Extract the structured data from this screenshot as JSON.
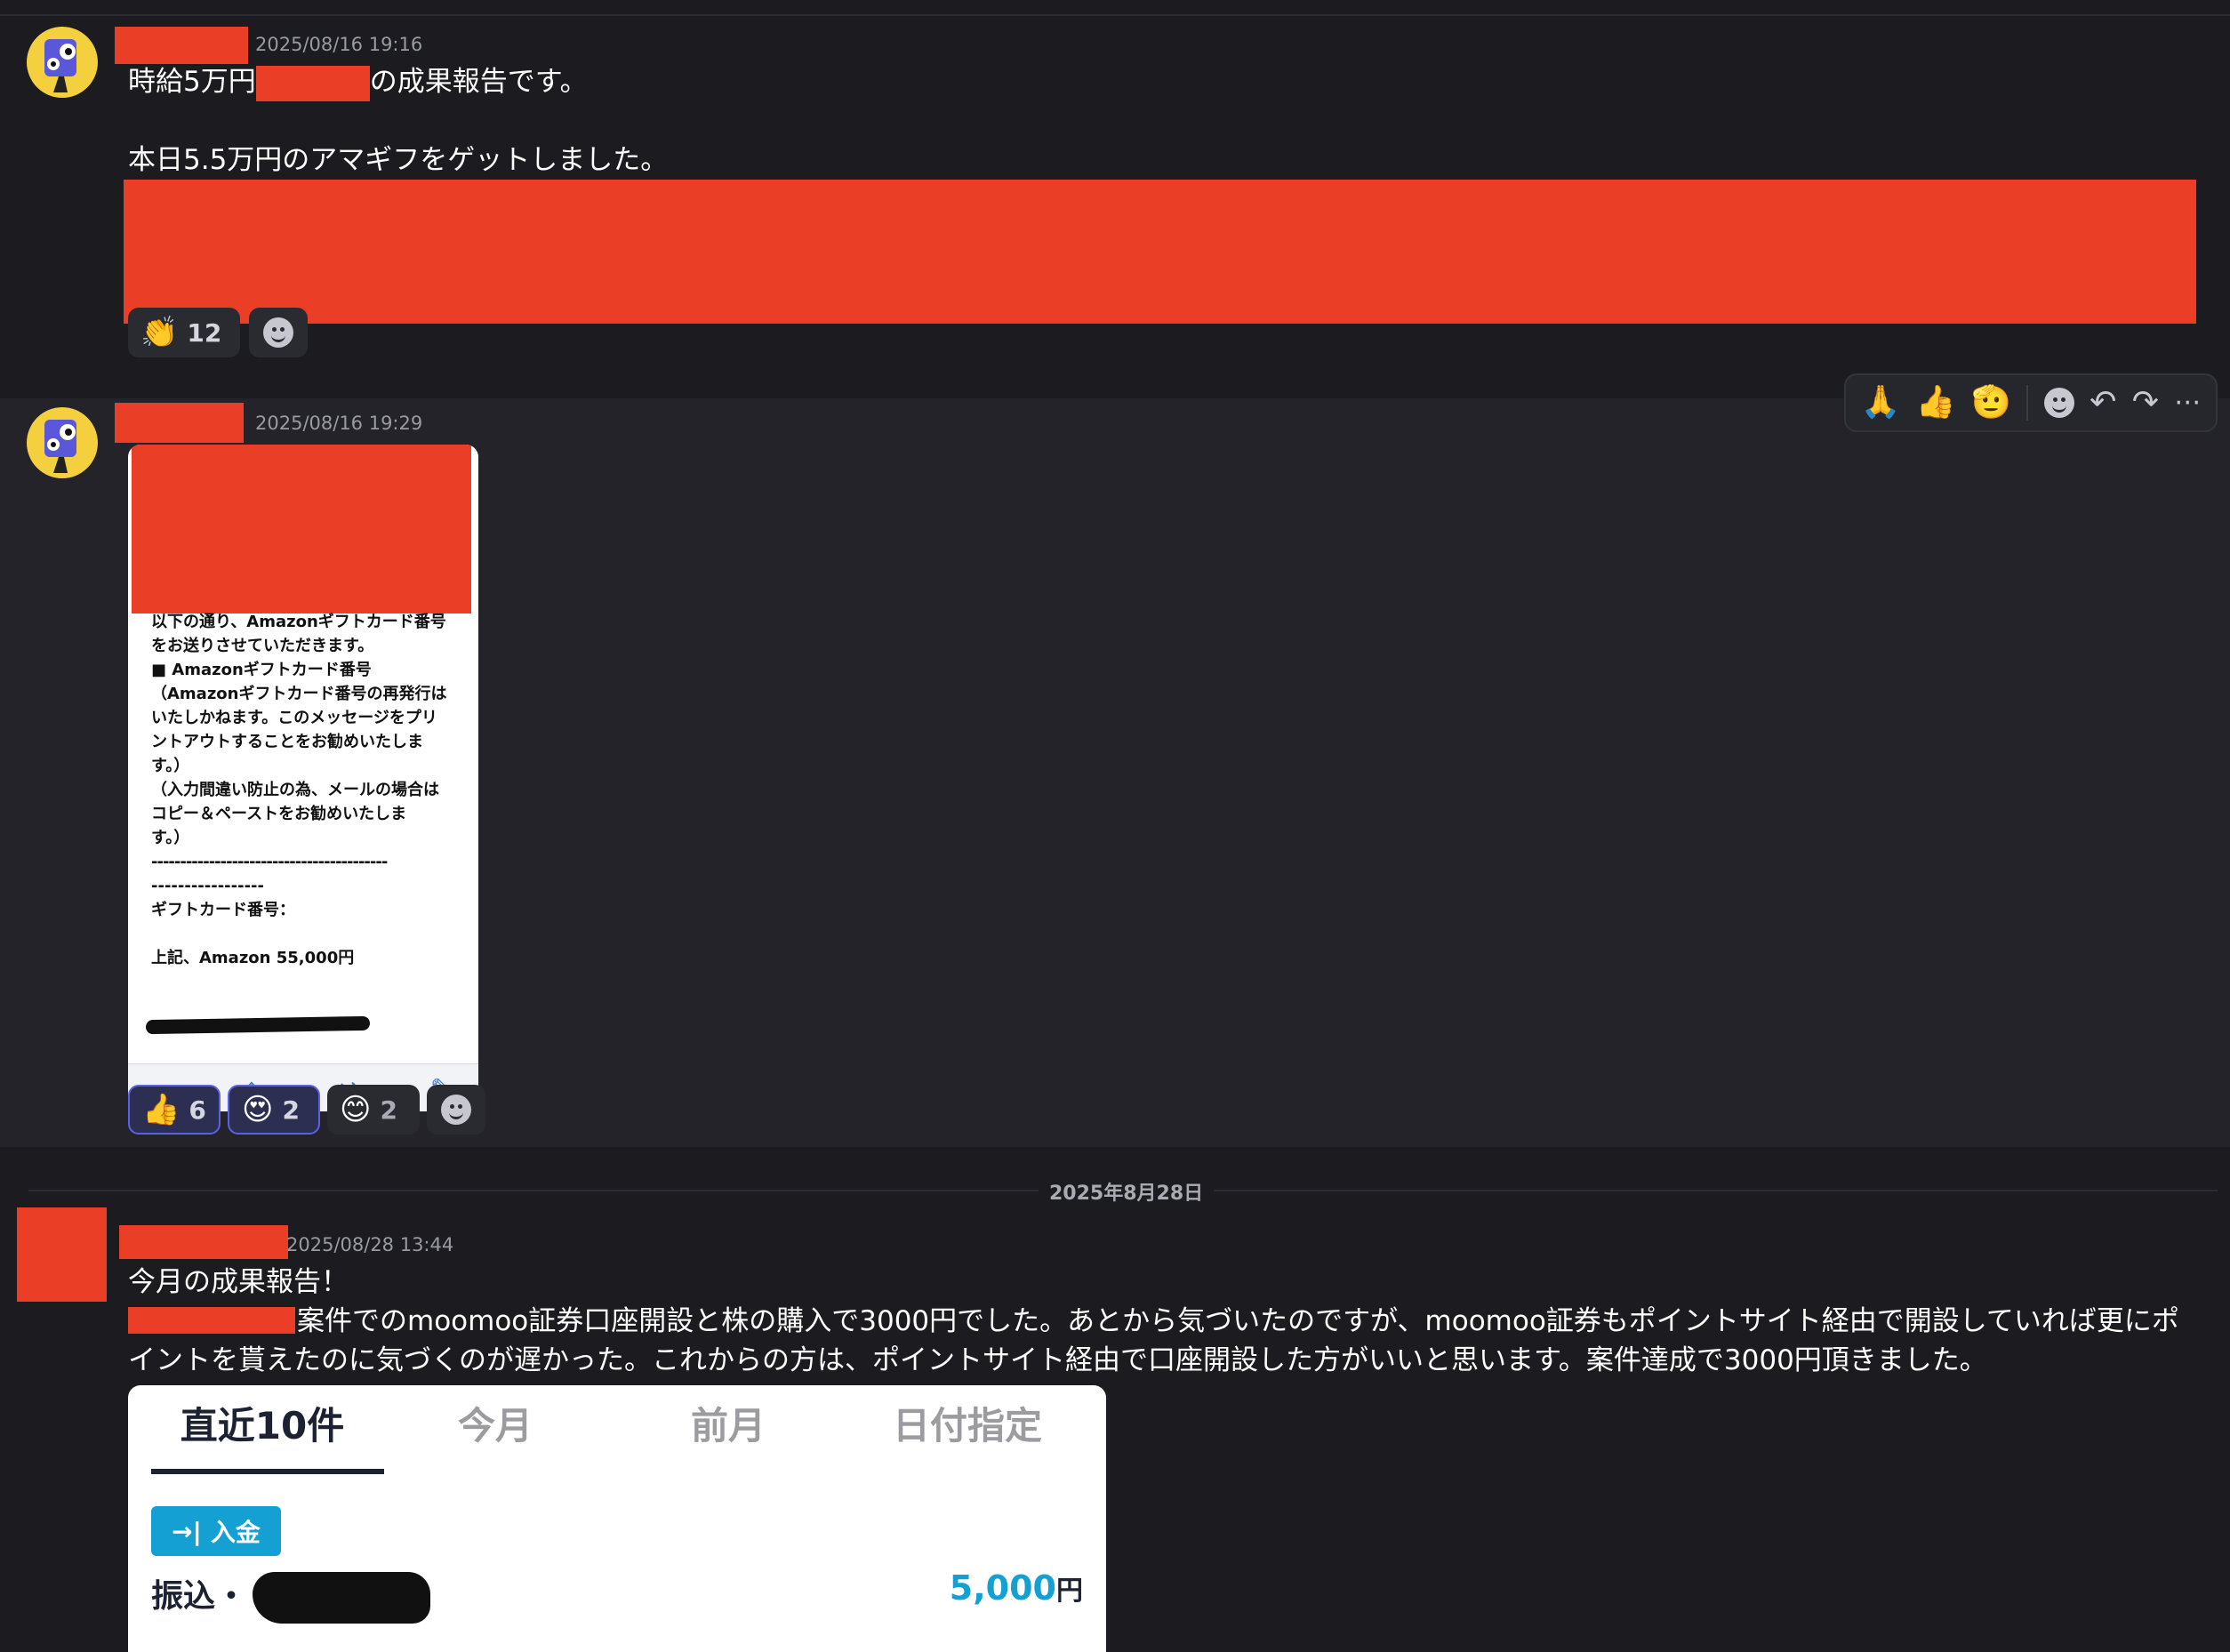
{
  "messages": [
    {
      "timestamp": "2025/08/16 19:16",
      "line1_before": "時給5万円",
      "line1_after": "の成果報告です。",
      "line2": "本日5.5万円のアマギフをゲットしました。",
      "reactions": [
        {
          "emoji": "👏",
          "count": "12"
        }
      ]
    },
    {
      "timestamp": "2025/08/16 19:29",
      "email_lines": [
        "以下の通り、Amazonギフトカード番号",
        "をお送りさせていただきます。",
        "",
        "■ Amazonギフトカード番号",
        "（Amazonギフトカード番号の再発行は",
        "いたしかねます。このメッセージをプリ",
        "ントアウトすることをお勧めいたしま",
        "す。）",
        "（入力間違い防止の為、メールの場合は",
        "コピー＆ペーストをお勧めいたしま",
        "す。）",
        "",
        "-----------------------------------------",
        "-----------------",
        "ギフトカード番号：",
        "",
        "上記、Amazon 55,000円"
      ],
      "reactions": [
        {
          "emoji": "👍",
          "count": "6"
        },
        {
          "emoji": "😍",
          "count": "2"
        },
        {
          "emoji": "😊",
          "count": "2"
        }
      ]
    },
    {
      "timestamp": "2025/08/28 13:44",
      "line1": "今月の成果報告！",
      "line2": "案件でのmoomoo証券口座開設と株の購入で3000円でした。あとから気づいたのですが、moomoo証券もポイントサイト経由で開設していれば更にポ",
      "line3": "イントを貰えたのに気づくのが遅かった。これからの方は、ポイントサイト経由で口座開設した方がいいと思います。案件達成で3000円頂きました。",
      "screenshot": {
        "tabs": [
          "直近10件",
          "今月",
          "前月",
          "日付指定"
        ],
        "deposit_label": "入金",
        "bank_label": "振込・",
        "amount": "5,000",
        "currency": "円"
      }
    }
  ],
  "date_separator": "2025年8月28日",
  "toolbar": {
    "emojis": [
      "🙏",
      "👍",
      "🫡"
    ]
  },
  "colors": {
    "background": "#1b1b20",
    "redaction": "#ea3f26",
    "accent_blue": "#14a0d2",
    "reaction_active_border": "#5b61e6"
  }
}
